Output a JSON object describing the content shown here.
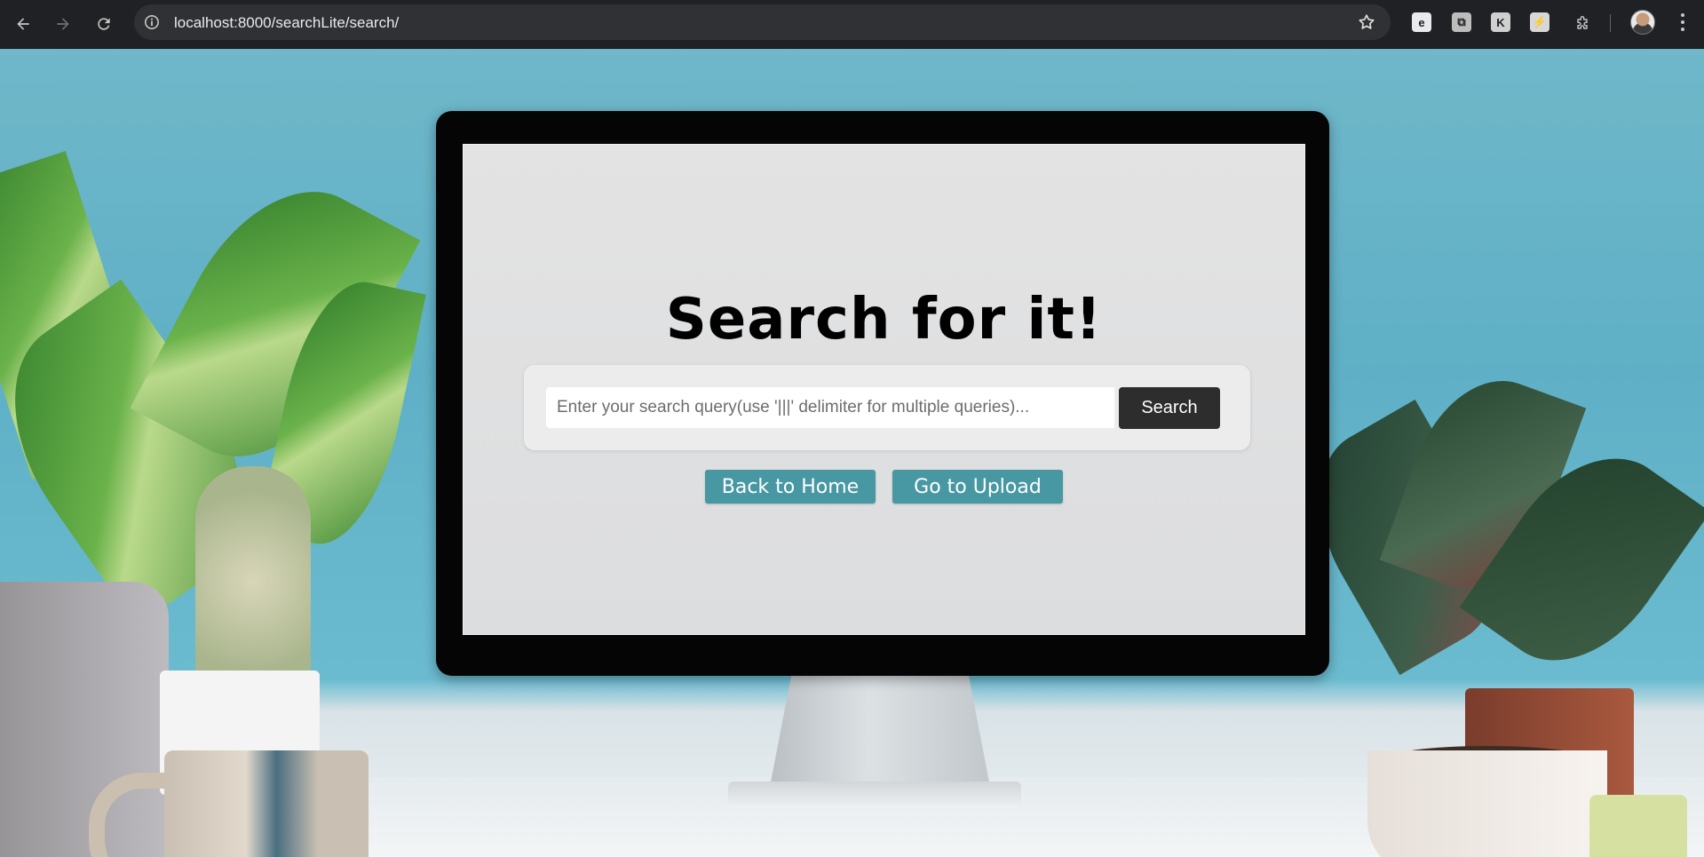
{
  "browser": {
    "url": "localhost:8000/searchLite/search/",
    "nav": {
      "back_icon": "arrow-left-icon",
      "forward_icon": "arrow-right-icon",
      "reload_icon": "reload-icon"
    },
    "extensions": [
      {
        "name": "extension-e-icon",
        "glyph": "e",
        "color": "#e8eaed"
      },
      {
        "name": "extension-copy-icon",
        "glyph": "⧉",
        "color": "#bdbdbd"
      },
      {
        "name": "extension-k-icon",
        "glyph": "K",
        "color": "#cfcfcf"
      },
      {
        "name": "extension-slash-icon",
        "glyph": "⚡",
        "color": "#d7d7d7"
      }
    ]
  },
  "page": {
    "title": "Search for it!",
    "search": {
      "placeholder": "Enter your search query(use '|||' delimiter for multiple queries)...",
      "value": "",
      "button_label": "Search"
    },
    "links": {
      "home_label": "Back to Home",
      "upload_label": "Go to Upload"
    }
  },
  "colors": {
    "background_wall": "#5fb0c6",
    "search_button": "#2d2d2d",
    "link_button": "#4898a3"
  }
}
